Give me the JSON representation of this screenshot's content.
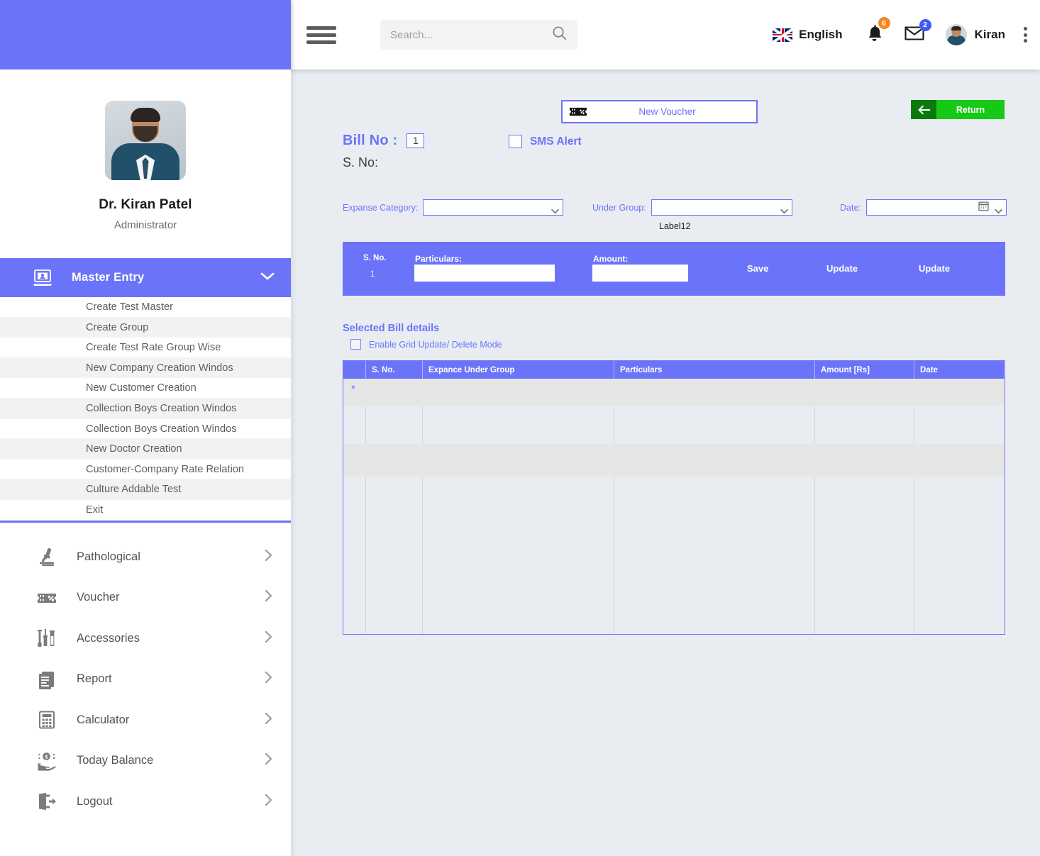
{
  "topbar": {
    "menu_icon": "hamburger-icon",
    "search": {
      "placeholder": "Search...",
      "value": "",
      "icon": "search-icon"
    },
    "language": {
      "label": "English",
      "flag": "uk-flag-icon"
    },
    "notifications": {
      "icon": "bell-icon",
      "count": "6",
      "color": "#f4871f"
    },
    "messages": {
      "icon": "envelope-icon",
      "count": "2",
      "color": "#3d5afe"
    },
    "user": {
      "name": "Kiran",
      "avatar": "user-avatar"
    },
    "kebab_icon": "more-vertical-icon"
  },
  "sidebar": {
    "profile": {
      "name": "Dr. Kiran Patel",
      "role": "Administrator",
      "avatar": "profile-photo"
    },
    "master_entry": {
      "label": "Master Entry",
      "icon": "computer-user-icon",
      "chevron": "chevron-down-icon",
      "expanded": true,
      "items": [
        "Create Test Master",
        "Create Group",
        "Create Test Rate Group Wise",
        "New Company Creation Windos",
        "New Customer Creation",
        "Collection Boys Creation Windos",
        "Collection Boys Creation Windos",
        "New Doctor Creation",
        "Customer-Company Rate Relation",
        "Culture Addable Test",
        "Exit"
      ]
    },
    "nav": [
      {
        "label": "Pathological",
        "icon": "microscope-icon"
      },
      {
        "label": "Voucher",
        "icon": "voucher-ticket-icon"
      },
      {
        "label": "Accessories",
        "icon": "syringe-vials-icon"
      },
      {
        "label": "Report",
        "icon": "report-document-icon"
      },
      {
        "label": "Calculator",
        "icon": "calculator-icon"
      },
      {
        "label": "Today Balance",
        "icon": "money-hand-icon"
      },
      {
        "label": "Logout",
        "icon": "logout-icon"
      }
    ],
    "nav_arrow_icon": "chevron-right-icon"
  },
  "main": {
    "new_voucher_button": {
      "label": "New Voucher",
      "icon": "voucher-ticket-icon"
    },
    "return_button": {
      "label": "Return",
      "icon": "arrow-left-icon"
    },
    "bill_no": {
      "label": "Bill No :",
      "value": "1"
    },
    "sms_alert": {
      "label": "SMS Alert",
      "checked": false
    },
    "s_no": {
      "label": "S. No:"
    },
    "expanse_category": {
      "label": "Expanse Category:",
      "value": ""
    },
    "under_group": {
      "label": "Under Group:",
      "value": ""
    },
    "label12": "Label12",
    "date": {
      "label": "Date:",
      "value": "",
      "icon": "calendar-icon"
    },
    "entry_bar": {
      "sno_header": "S. No.",
      "sno_value": "1",
      "particulars_label": "Particulars:",
      "particulars_value": "",
      "amount_label": "Amount:",
      "amount_value": "",
      "save_label": "Save",
      "update1_label": "Update",
      "update2_label": "Update"
    },
    "selected_bill": {
      "title": "Selected Bill details",
      "grid_mode": {
        "label": "Enable Grid Update/ Delete Mode",
        "checked": false
      },
      "columns": [
        "",
        "S. No.",
        "Expance Under Group",
        "Particulars",
        "Amount [Rs]",
        "Date"
      ],
      "rows": [],
      "new_row_marker": "*"
    }
  },
  "colors": {
    "primary": "#6b74f8",
    "background": "#e9edf2",
    "green_dark": "#0a7a0a",
    "green": "#17c917"
  }
}
